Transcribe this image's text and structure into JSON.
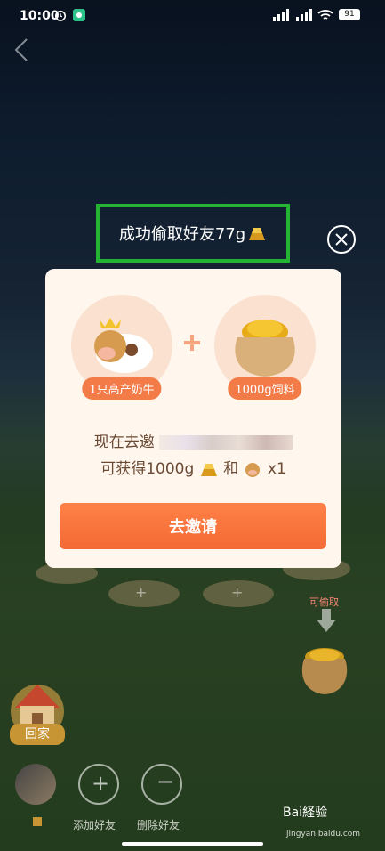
{
  "status_bar": {
    "time": "10:00",
    "battery": "91"
  },
  "toast": {
    "text": "成功偷取好友77g"
  },
  "card": {
    "reward_1_label": "1只高产奶牛",
    "reward_2_label": "1000g饲料",
    "invite_line_1": "现在去邀",
    "invite_line_2_prefix": "可获得1000g",
    "invite_line_2_mid": "和",
    "invite_line_2_suffix": "x1",
    "button_label": "去邀请"
  },
  "background": {
    "can_steal_label": "可偷取",
    "home_label": "回家",
    "add_friend_label": "添加好友",
    "delete_friend_label": "删除好友"
  },
  "watermark": {
    "brand": "Bai経验",
    "url": "jingyan.baidu.com"
  },
  "colors": {
    "toast_border": "#25b333",
    "button": "#f36a35",
    "card_bg": "#fff6ee"
  }
}
